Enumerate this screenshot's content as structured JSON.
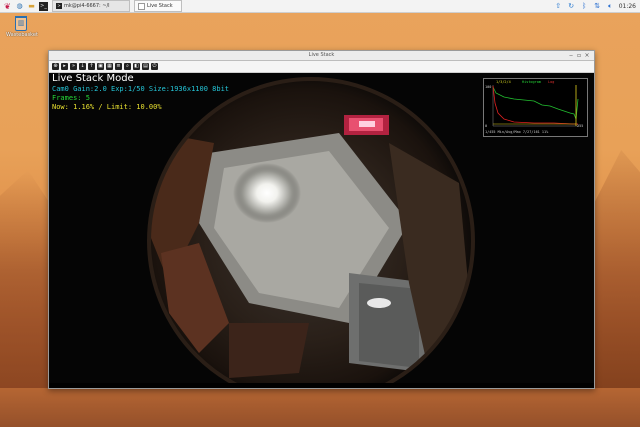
{
  "taskbar": {
    "tasks": [
      {
        "label": "mk@pi4-6667: ~/l",
        "icon": "terminal-icon"
      },
      {
        "label": "Live Stack",
        "icon": "window-icon"
      }
    ],
    "clock": "01:26"
  },
  "desktop": {
    "trash_label": "Wastebasket"
  },
  "window": {
    "title": "Live Stack",
    "toolbar_icons": [
      "crosshair-icon",
      "play-icon",
      "forward-icon",
      "download-icon",
      "upload-icon",
      "image-icon",
      "grid-icon",
      "stack-icon",
      "zoom-icon",
      "compare-icon",
      "save-icon",
      "exit-icon"
    ]
  },
  "hud": {
    "mode": "Live Stack Mode",
    "camera": "Cam0 Gain:2.0 Exp:1/50 Size:1936x1100 8bit",
    "frames": "Frames: 5",
    "limit": "Now: 1.16% / Limit: 10.00%"
  },
  "histogram": {
    "top_labels": [
      "1/3/2/4",
      "Histogram",
      "Log"
    ],
    "left_top": "100",
    "left_bottom": "0",
    "right_bottom": "255",
    "bottom_label": "1/455 Min/Avg/Max 7/27/161 11%"
  },
  "colors": {
    "cam_text": "#25c6d8",
    "frames_text": "#25d838",
    "limit_text": "#e8e030",
    "hist_green": "#22c030",
    "hist_red": "#e02020",
    "hist_yellow": "#e0d020"
  }
}
